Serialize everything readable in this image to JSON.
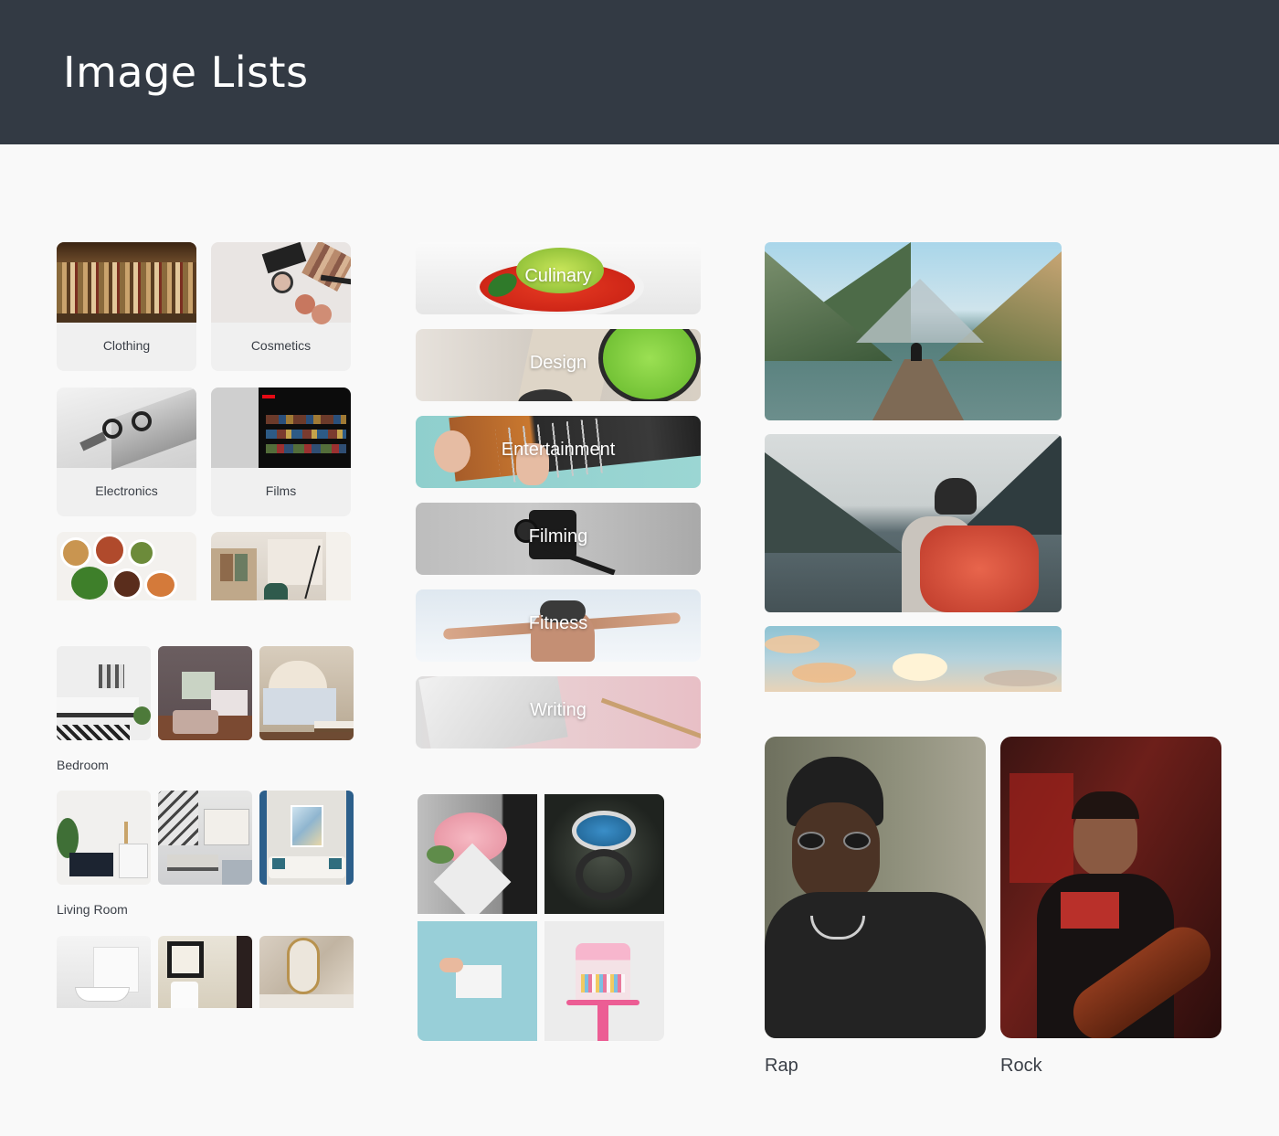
{
  "header": {
    "title": "Image Lists"
  },
  "categories": [
    {
      "label": "Clothing"
    },
    {
      "label": "Cosmetics"
    },
    {
      "label": "Electronics"
    },
    {
      "label": "Films"
    }
  ],
  "rooms": [
    {
      "label": "Bedroom"
    },
    {
      "label": "Living Room"
    }
  ],
  "banners": [
    {
      "label": "Culinary"
    },
    {
      "label": "Design"
    },
    {
      "label": "Entertainment"
    },
    {
      "label": "Filming"
    },
    {
      "label": "Fitness"
    },
    {
      "label": "Writing"
    }
  ],
  "genres": [
    {
      "label": "Rap"
    },
    {
      "label": "Rock"
    }
  ],
  "colors": {
    "header_bg": "#333a44",
    "page_bg": "#f9f9f9",
    "card_bg": "#f0f0f0",
    "text": "#3a3f47"
  }
}
